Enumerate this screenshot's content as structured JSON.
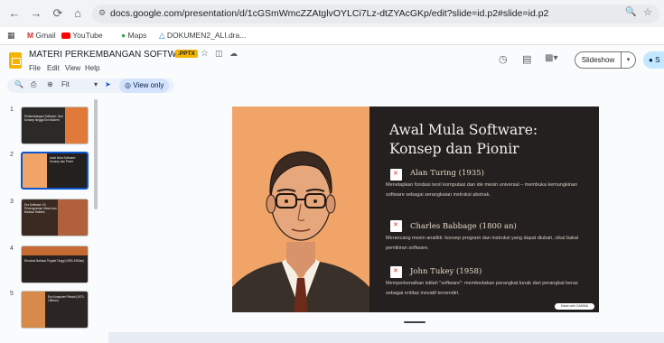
{
  "browser": {
    "url": "docs.google.com/presentation/d/1cGSmWmcZZAtglvOYLCi7Lz-dtZYAcGKp/edit?slide=id.p2#slide=id.p2",
    "bookmarks": [
      {
        "label": "Gmail",
        "icon": "gmail-icon"
      },
      {
        "label": "YouTube",
        "icon": "youtube-icon"
      },
      {
        "label": "Maps",
        "icon": "maps-icon"
      },
      {
        "label": "DOKUMEN2_ALI.dra...",
        "icon": "drive-icon"
      }
    ]
  },
  "header": {
    "title": "MATERI PERKEMBANGAN SOFTWARE",
    "badge": ".PPTX",
    "menu": [
      "File",
      "Edit",
      "View",
      "Help"
    ],
    "slideshow_label": "Slideshow",
    "share_label": "S"
  },
  "toolbar": {
    "zoom_label": "Fit",
    "view_only_label": "View only"
  },
  "filmstrip": {
    "thumbs": [
      {
        "number": "1",
        "text": "Perkembangan Software: Dari Konsep hingga Era Modern"
      },
      {
        "number": "2",
        "text": "Awal Mula Software: Konsep dan Pionir"
      },
      {
        "number": "3",
        "text": "Era Software 1G: Pemrograman Mesin dan Bahasa Rakitan"
      },
      {
        "number": "4",
        "text": "Revolusi Bahasa Tingkat Tinggi (1950-1960an)"
      },
      {
        "number": "5",
        "text": "Era Komputer Pribadi (1970-1980an)"
      }
    ]
  },
  "slide": {
    "title": "Awal Mula Software: Konsep dan Pionir",
    "points": [
      {
        "heading": "Alan Turing (1935)",
        "body": "Menetapkan fondasi teori komputasi dan ide mesin universal – membuka kemungkinan software sebagai serangkaian instruksi abstrak."
      },
      {
        "heading": "Charles Babbage (1800 an)",
        "body": "Merancang mesin analitik: konsep program dan instruksi yang dapat diubah, cikal bakal pemikiran software."
      },
      {
        "heading": "John Tukey (1958)",
        "body": "Memperkenalkan istilah \"software\": membedakan perangkat lunak dari perangkat keras sebagai entitas inovatif tersendiri."
      }
    ],
    "badge": "Made with GAMMA"
  },
  "colors": {
    "slide_bg": "#23201f",
    "portrait_bg": "#f0a468",
    "accent": "#0b57d0"
  }
}
